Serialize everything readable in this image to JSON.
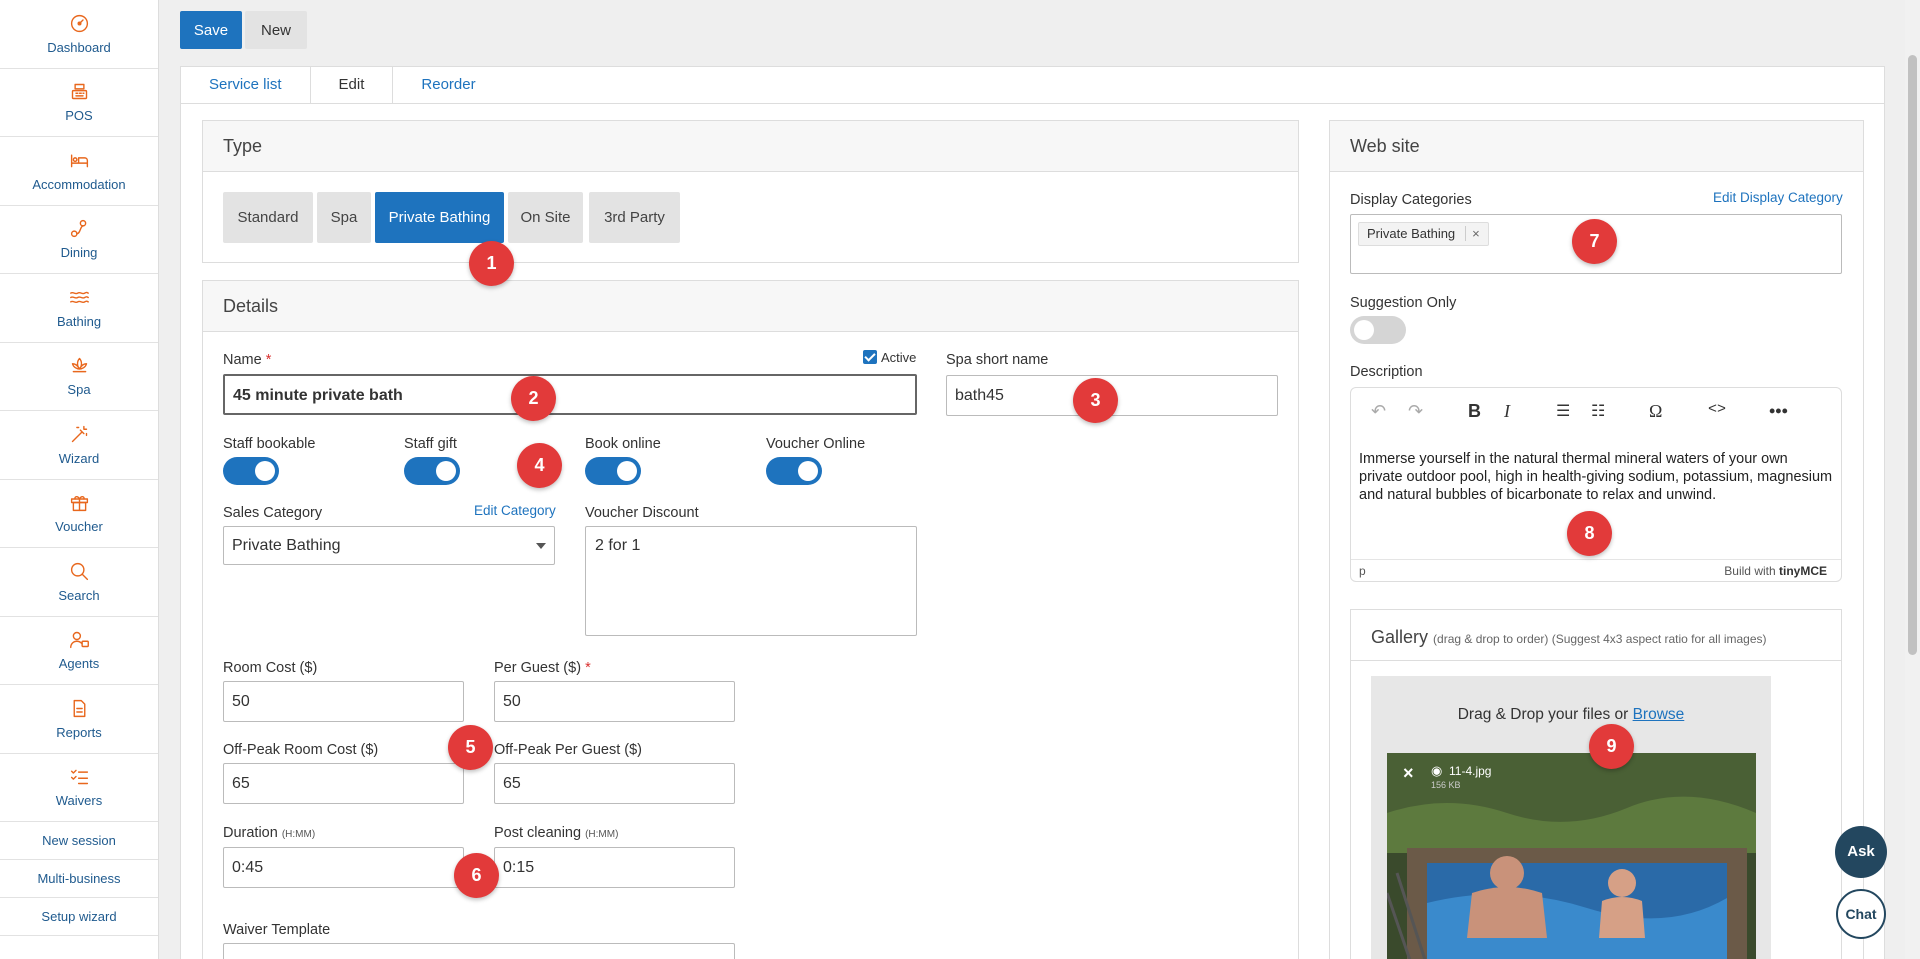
{
  "sidebar": {
    "items": [
      {
        "label": "Dashboard",
        "icon": "dashboard-icon"
      },
      {
        "label": "POS",
        "icon": "register-icon"
      },
      {
        "label": "Accommodation",
        "icon": "bed-icon"
      },
      {
        "label": "Dining",
        "icon": "dining-icon"
      },
      {
        "label": "Bathing",
        "icon": "waves-icon"
      },
      {
        "label": "Spa",
        "icon": "lotus-icon"
      },
      {
        "label": "Wizard",
        "icon": "magic-wand-icon"
      },
      {
        "label": "Voucher",
        "icon": "gift-icon"
      },
      {
        "label": "Search",
        "icon": "search-icon"
      },
      {
        "label": "Agents",
        "icon": "agents-icon"
      },
      {
        "label": "Reports",
        "icon": "document-icon"
      },
      {
        "label": "Waivers",
        "icon": "checklist-icon"
      }
    ],
    "text_items": [
      "New session",
      "Multi-business",
      "Setup wizard"
    ]
  },
  "toolbar": {
    "save_label": "Save",
    "new_label": "New"
  },
  "tabs": [
    {
      "label": "Service list"
    },
    {
      "label": "Edit"
    },
    {
      "label": "Reorder"
    }
  ],
  "type_panel": {
    "title": "Type",
    "options": [
      "Standard",
      "Spa",
      "Private Bathing",
      "On Site",
      "3rd Party"
    ]
  },
  "details": {
    "title": "Details",
    "name_label": "Name",
    "required": "*",
    "active_label": "Active",
    "name_value": "45 minute private bath",
    "spa_short_label": "Spa short name",
    "spa_short_value": "bath45",
    "toggles": [
      "Staff bookable",
      "Staff gift",
      "Book online",
      "Voucher Online"
    ],
    "sales_category_label": "Sales Category",
    "edit_category": "Edit Category",
    "sales_category_value": "Private Bathing",
    "voucher_discount_label": "Voucher Discount",
    "voucher_discount_value": "2 for 1",
    "room_cost_label": "Room Cost ($)",
    "room_cost_value": "50",
    "per_guest_label": "Per Guest ($)",
    "per_guest_value": "50",
    "offpeak_room_label": "Off-Peak Room Cost ($)",
    "offpeak_room_value": "65",
    "offpeak_guest_label": "Off-Peak Per Guest ($)",
    "offpeak_guest_value": "65",
    "duration_label": "Duration",
    "hmm": "(H:MM)",
    "duration_value": "0:45",
    "post_cleaning_label": "Post cleaning",
    "post_cleaning_value": "0:15",
    "waiver_label": "Waiver Template"
  },
  "website": {
    "title": "Web site",
    "display_categories_label": "Display Categories",
    "edit_display_category": "Edit Display Category",
    "tag": "Private Bathing",
    "tag_remove": "×",
    "suggestion_label": "Suggestion Only",
    "description_label": "Description",
    "description_text": "Immerse yourself in the natural thermal mineral waters of your own private outdoor pool, high in health-giving sodium, potassium, magnesium and natural bubbles of bicarbonate to relax and unwind.",
    "editor_status_path": "p",
    "editor_brand": "Build with",
    "editor_brand_name": "tinyMCE",
    "gallery_title": "Gallery",
    "gallery_hint": "(drag & drop to order) (Suggest 4x3 aspect ratio for all images)",
    "drop_text": "Drag & Drop your files or",
    "browse_label": "Browse",
    "file_name": "11-4.jpg",
    "file_size": "156 KB",
    "file_remove": "×"
  },
  "badges": [
    "1",
    "2",
    "3",
    "4",
    "5",
    "6",
    "7",
    "8",
    "9"
  ],
  "float_buttons": {
    "ask": "Ask",
    "chat": "Chat"
  },
  "colors": {
    "primary": "#1e73be",
    "accent": "#e8671d",
    "badge": "#e23a3a",
    "dark": "#23475f"
  }
}
